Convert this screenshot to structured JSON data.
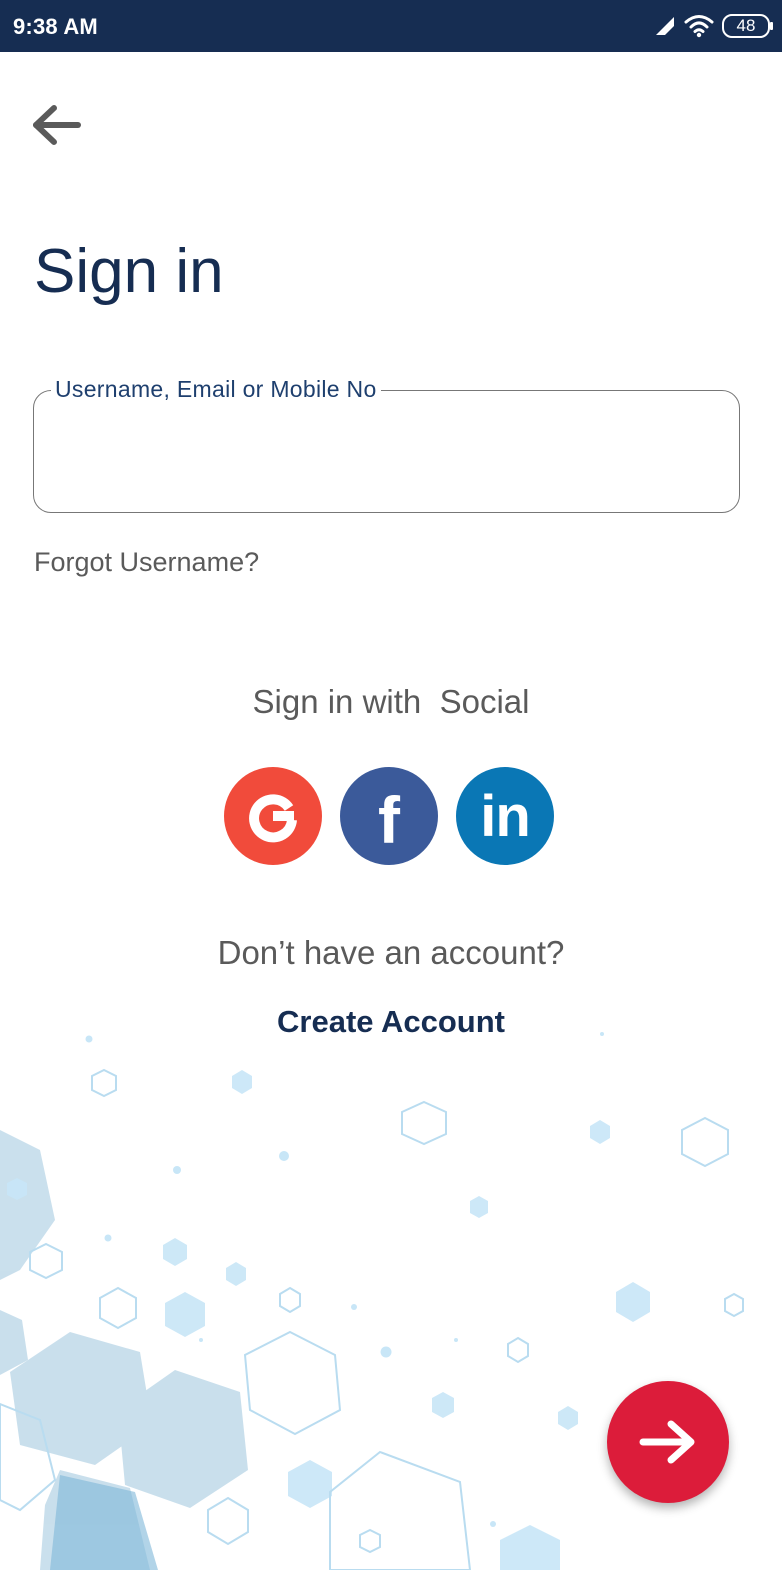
{
  "status_bar": {
    "time": "9:38 AM",
    "battery": "48"
  },
  "page": {
    "title": "Sign in"
  },
  "login_field": {
    "label": "Username, Email or Mobile No",
    "value": ""
  },
  "links": {
    "forgot_username": "Forgot Username?"
  },
  "social": {
    "heading": "Sign in with  Social",
    "providers": [
      {
        "name": "google",
        "color": "#f14b3b"
      },
      {
        "name": "facebook",
        "color": "#3b5a9a"
      },
      {
        "name": "linkedin",
        "color": "#0a77b5"
      }
    ]
  },
  "signup": {
    "prompt": "Don’t have an account?",
    "create_label": "Create Account"
  },
  "colors": {
    "primary": "#162d52",
    "accent": "#dc1c3a",
    "text_muted": "#5a5a5a"
  },
  "icons": {
    "back": "arrow-left-icon",
    "next": "arrow-right-icon",
    "signal": "signal-icon",
    "wifi": "wifi-icon"
  }
}
